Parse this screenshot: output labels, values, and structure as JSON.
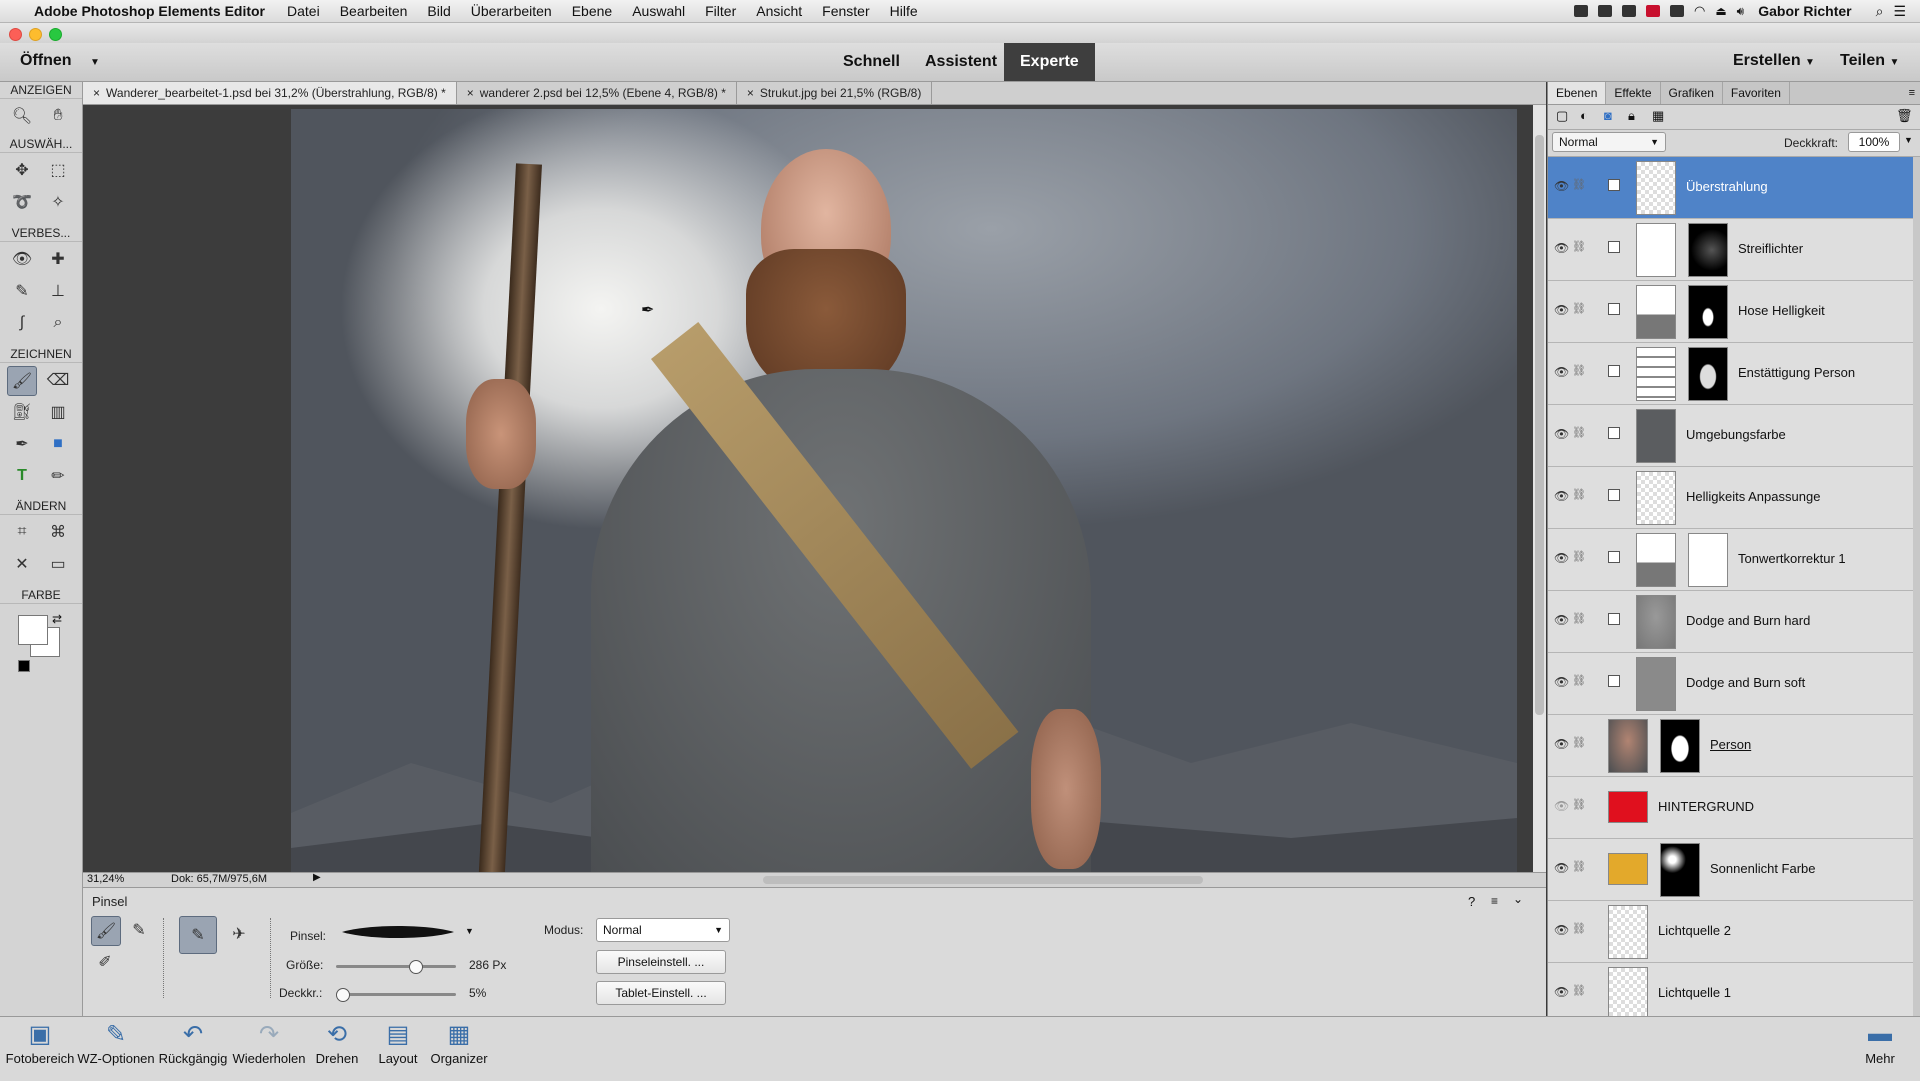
{
  "menubar": {
    "app_name": "Adobe Photoshop Elements Editor",
    "items": [
      "Datei",
      "Bearbeiten",
      "Bild",
      "Überarbeiten",
      "Ebene",
      "Auswahl",
      "Filter",
      "Ansicht",
      "Fenster",
      "Hilfe"
    ],
    "user": "Gabor Richter"
  },
  "modebar": {
    "open": "Öffnen",
    "modes": [
      "Schnell",
      "Assistent",
      "Experte"
    ],
    "active_mode": "Experte",
    "create": "Erstellen",
    "share": "Teilen"
  },
  "tools": {
    "sections": [
      "ANZEIGEN",
      "AUSWÄH...",
      "VERBES...",
      "ZEICHNEN",
      "ÄNDERN",
      "FARBE"
    ]
  },
  "doc_tabs": [
    {
      "label": "Wanderer_bearbeitet-1.psd bei 31,2% (Überstrahlung, RGB/8) *",
      "active": true
    },
    {
      "label": "wanderer 2.psd bei 12,5% (Ebene 4, RGB/8) *",
      "active": false
    },
    {
      "label": "Strukut.jpg bei 21,5% (RGB/8)",
      "active": false
    }
  ],
  "status": {
    "zoom": "31,24%",
    "doc": "Dok: 65,7M/975,6M"
  },
  "options": {
    "tool_name": "Pinsel",
    "brush_label": "Pinsel:",
    "size_label": "Größe:",
    "size_value": "286 Px",
    "size_fraction": 0.66,
    "opacity_label": "Deckkr.:",
    "opacity_value": "5%",
    "opacity_fraction": 0.05,
    "mode_label": "Modus:",
    "mode_value": "Normal",
    "brush_settings_btn": "Pinseleinstell. ...",
    "tablet_settings_btn": "Tablet-Einstell. ..."
  },
  "bottombar": {
    "buttons": [
      "Fotobereich",
      "WZ-Optionen",
      "Rückgängig",
      "Wiederholen",
      "Drehen",
      "Layout",
      "Organizer"
    ],
    "more": "Mehr"
  },
  "panel": {
    "tabs": [
      "Ebenen",
      "Effekte",
      "Grafiken",
      "Favoriten"
    ],
    "blend_mode": "Normal",
    "opacity_label": "Deckkraft:",
    "opacity_value": "100%",
    "layers": [
      "Überstrahlung",
      "Streiflichter",
      "Hose Helligkeit",
      "Enstättigung Person",
      "Umgebungsfarbe",
      "Helligkeits Anpassunge",
      "Tonwertkorrektur 1",
      "Dodge and Burn hard",
      "Dodge and Burn soft",
      "Person",
      "HINTERGRUND",
      "Sonnenlicht Farbe",
      "Lichtquelle 2",
      "Lichtquelle 1"
    ]
  },
  "colors": {
    "accent": "#4f83c8",
    "hintergrund": "#e0101e",
    "sonnenlicht": "#e3a92b"
  }
}
